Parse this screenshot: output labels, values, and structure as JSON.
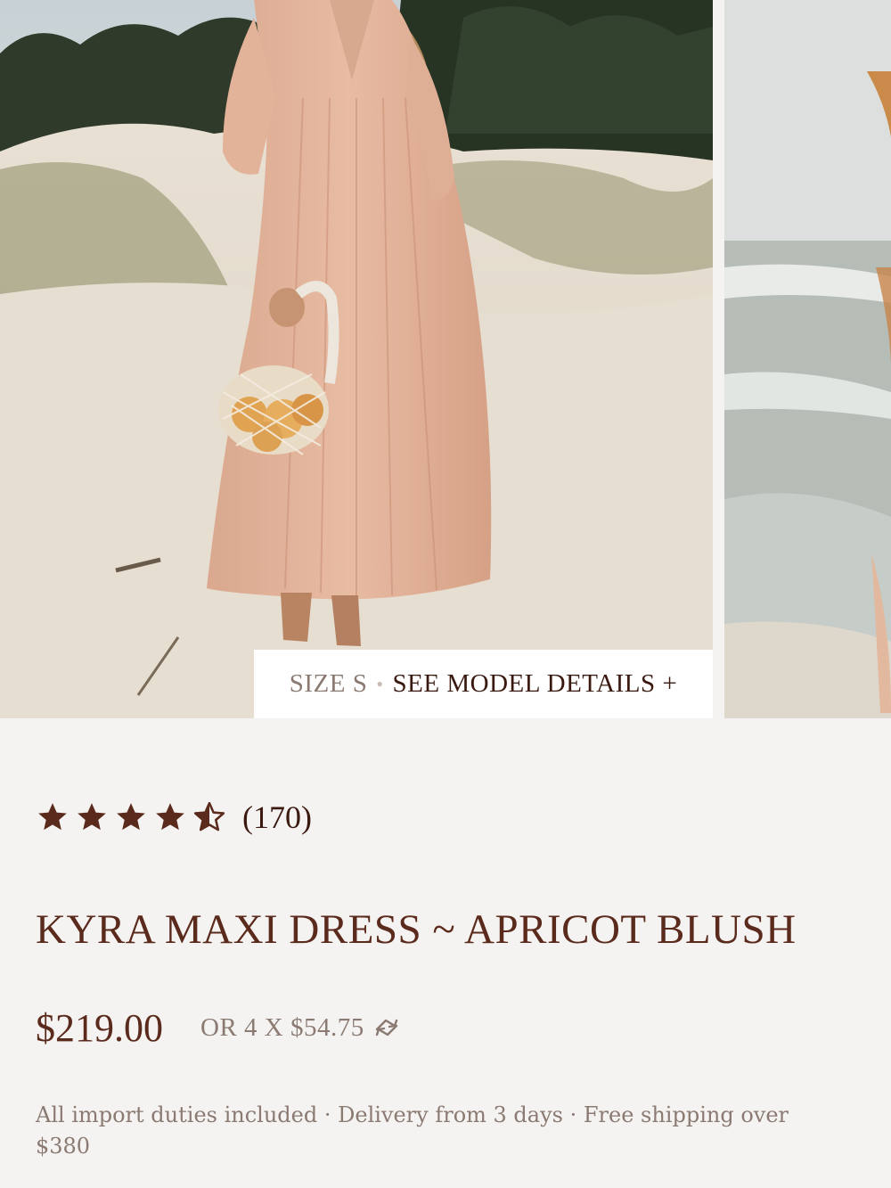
{
  "gallery": {
    "model_badge": {
      "size_text": "SIZE S",
      "separator": "•",
      "details_link": "SEE MODEL DETAILS +"
    }
  },
  "rating": {
    "value": 4.5,
    "max": 5,
    "count_text": "(170)"
  },
  "product": {
    "title": "KYRA MAXI DRESS ~ APRICOT BLUSH",
    "price": "$219.00",
    "installments": "OR 4 X $54.75",
    "installments_icon": "afterpay-loop-icon",
    "shipping_note": "All import duties included · Delivery from 3 days · Free shipping over $380"
  },
  "colors": {
    "brand_text": "#5a2a1c",
    "muted_text": "#8a7a72",
    "background": "#f5f3f1"
  }
}
